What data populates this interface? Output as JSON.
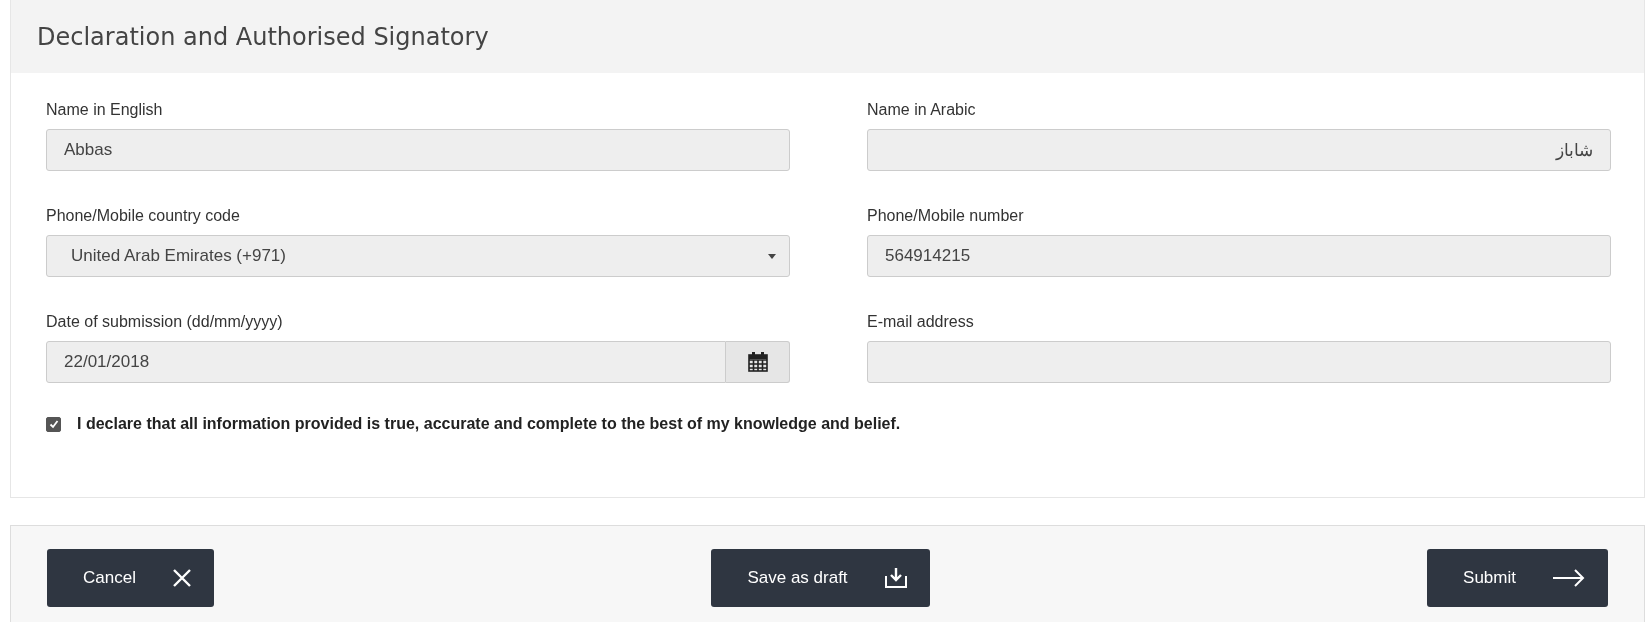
{
  "section": {
    "title": "Declaration and Authorised Signatory"
  },
  "fields": [
    {
      "label": "Name in English",
      "kind": "text",
      "value": "Abbas"
    },
    {
      "label": "Name in Arabic",
      "kind": "text",
      "value": "شاباز"
    },
    {
      "label": "Phone/Mobile country code",
      "kind": "select",
      "value": "United Arab Emirates (+971)"
    },
    {
      "label": "Phone/Mobile number",
      "kind": "text",
      "value": "564914215"
    },
    {
      "label": "Date of submission (dd/mm/yyyy)",
      "kind": "date",
      "value": "22/01/2018"
    },
    {
      "label": "E-mail address",
      "kind": "text"
    }
  ],
  "declaration": {
    "text": "I declare that all information provided is true, accurate and complete to the best of my knowledge and belief.",
    "checked": true
  },
  "buttons": [
    {
      "label": "Cancel",
      "kind": "cancel"
    },
    {
      "label": "Save as draft",
      "kind": "draft"
    },
    {
      "label": "Submit",
      "kind": "submit"
    }
  ]
}
